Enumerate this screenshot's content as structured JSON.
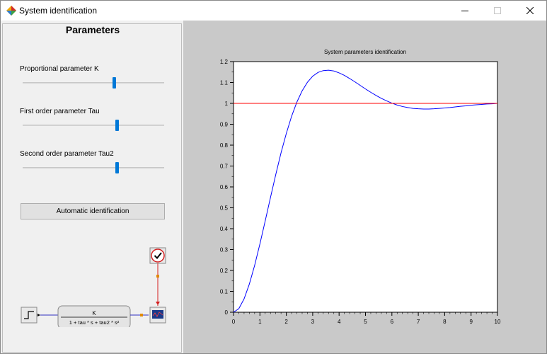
{
  "window": {
    "title": "System identification"
  },
  "left": {
    "heading": "Parameters",
    "params": [
      {
        "label": "Proportional parameter K",
        "position": 0.645
      },
      {
        "label": "First order parameter Tau",
        "position": 0.665
      },
      {
        "label": "Second order parameter Tau2",
        "position": 0.665
      }
    ],
    "button_label": "Automatic identification",
    "diagram": {
      "tf_numerator": "K",
      "tf_denominator": "1 + tau * s + tau2 * s²"
    }
  },
  "colors": {
    "accent": "#0078d7",
    "response": "#0000ff",
    "setpoint": "#ff0000",
    "plot_bg": "#ffffff",
    "panel_bg": "#c9c9c9"
  },
  "chart_data": {
    "type": "line",
    "title": "System parameters identification",
    "xlabel": "",
    "ylabel": "",
    "xlim": [
      0,
      10
    ],
    "ylim": [
      0,
      1.2
    ],
    "xticks": [
      "0",
      "1",
      "2",
      "3",
      "4",
      "5",
      "6",
      "7",
      "8",
      "9",
      "10"
    ],
    "yticks": [
      "0",
      "0.1",
      "0.2",
      "0.3",
      "0.4",
      "0.5",
      "0.6",
      "0.7",
      "0.8",
      "0.9",
      "1",
      "1.1",
      "1.2"
    ],
    "grid": false,
    "series": [
      {
        "color": "#0000ff",
        "x": [
          0,
          0.2,
          0.4,
          0.6,
          0.8,
          1.0,
          1.2,
          1.4,
          1.6,
          1.8,
          2.0,
          2.2,
          2.4,
          2.6,
          2.8,
          3.0,
          3.2,
          3.4,
          3.6,
          3.8,
          4.0,
          4.2,
          4.4,
          4.6,
          4.8,
          5.0,
          5.2,
          5.4,
          5.6,
          5.8,
          6.0,
          6.2,
          6.4,
          6.6,
          6.8,
          7.0,
          7.2,
          7.4,
          7.6,
          7.8,
          8.0,
          8.2,
          8.4,
          8.6,
          8.8,
          9.0,
          9.2,
          9.4,
          9.6,
          9.8,
          10.0
        ],
        "y": [
          0,
          0.017,
          0.064,
          0.135,
          0.224,
          0.327,
          0.437,
          0.549,
          0.659,
          0.763,
          0.856,
          0.938,
          1.006,
          1.06,
          1.101,
          1.13,
          1.148,
          1.157,
          1.159,
          1.155,
          1.146,
          1.134,
          1.119,
          1.103,
          1.086,
          1.069,
          1.053,
          1.038,
          1.024,
          1.012,
          1.001,
          0.992,
          0.985,
          0.98,
          0.976,
          0.974,
          0.973,
          0.973,
          0.974,
          0.976,
          0.978,
          0.98,
          0.983,
          0.986,
          0.988,
          0.991,
          0.993,
          0.995,
          0.997,
          0.998,
          1.0
        ]
      },
      {
        "color": "#ff0000",
        "x": [
          0,
          10
        ],
        "y": [
          1,
          1
        ]
      }
    ]
  }
}
